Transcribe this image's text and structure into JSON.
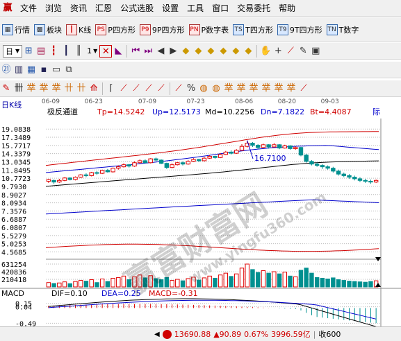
{
  "menu": {
    "logo": "赢",
    "items": [
      "文件",
      "浏览",
      "资讯",
      "汇恩",
      "公式选股",
      "设置",
      "工具",
      "窗口",
      "交易委托",
      "帮助"
    ]
  },
  "toolbar1": {
    "items": [
      "行情",
      "板块",
      "K线",
      "P四方形",
      "9P四方形",
      "P数字表",
      "T四方形",
      "9T四方形",
      "T数字"
    ]
  },
  "toolbar2": {
    "period": "日",
    "mode": "1"
  },
  "chart": {
    "title": "日K线",
    "indicator_name": "极反通道",
    "tp_label": "Tp=14.5242",
    "up_label": "Up=12.5173",
    "md_label": "Md=10.2256",
    "dn_label": "Dn=7.1822",
    "bt_label": "Bt=4.4087",
    "tail": "际",
    "date_labels": [
      "06-09",
      "06-23",
      "07-09",
      "07-23",
      "08-06",
      "08-20",
      "09-03"
    ],
    "price_ticks": [
      "19.0838",
      "17.3489",
      "15.7717",
      "14.3379",
      "13.0345",
      "11.8495",
      "10.7723",
      "9.7930",
      "8.9027",
      "8.0934",
      "7.3576",
      "6.6887",
      "6.0807",
      "5.5279",
      "5.0253",
      "4.5685"
    ],
    "peak_label": "16.7100",
    "volume_ticks": [
      "631254",
      "420836",
      "210418"
    ],
    "macd_title": "MACD",
    "dif_label": "DIF=0.10",
    "dea_label": "DEA=0.25",
    "macd_label": "MACD=-0.31",
    "macd_ticks": [
      "0.15",
      "0.04",
      "-0.49"
    ]
  },
  "chart_data": {
    "type": "candlestick",
    "candles": [
      [
        10.4,
        10.6,
        10.2,
        10.7
      ],
      [
        10.5,
        10.3,
        10.1,
        10.6
      ],
      [
        10.3,
        10.5,
        10.2,
        10.7
      ],
      [
        10.5,
        10.8,
        10.4,
        10.9
      ],
      [
        10.8,
        10.6,
        10.5,
        10.9
      ],
      [
        10.6,
        10.9,
        10.5,
        11.0
      ],
      [
        10.9,
        11.2,
        10.8,
        11.3
      ],
      [
        11.2,
        11.1,
        10.9,
        11.4
      ],
      [
        11.1,
        11.5,
        11.0,
        11.6
      ],
      [
        11.5,
        11.4,
        11.2,
        11.7
      ],
      [
        11.4,
        11.8,
        11.3,
        11.9
      ],
      [
        11.8,
        11.6,
        11.5,
        12.0
      ],
      [
        11.6,
        12.1,
        11.5,
        12.2
      ],
      [
        12.1,
        12.3,
        11.9,
        12.5
      ],
      [
        12.3,
        12.6,
        12.2,
        12.8
      ],
      [
        12.6,
        12.4,
        12.2,
        12.7
      ],
      [
        12.4,
        12.9,
        12.3,
        13.1
      ],
      [
        12.9,
        13.2,
        12.8,
        13.4
      ],
      [
        13.2,
        12.9,
        12.8,
        13.4
      ],
      [
        12.9,
        13.5,
        12.8,
        13.6
      ],
      [
        13.5,
        13.3,
        13.1,
        13.7
      ],
      [
        13.3,
        12.8,
        12.7,
        13.4
      ],
      [
        12.8,
        12.2,
        12.0,
        12.9
      ],
      [
        12.2,
        12.6,
        12.1,
        12.8
      ],
      [
        12.6,
        12.9,
        12.5,
        13.0
      ],
      [
        12.9,
        12.7,
        12.5,
        13.1
      ],
      [
        12.7,
        13.1,
        12.6,
        13.3
      ],
      [
        13.1,
        13.4,
        13.0,
        13.6
      ],
      [
        13.4,
        13.2,
        13.0,
        13.5
      ],
      [
        13.2,
        13.6,
        13.1,
        13.8
      ],
      [
        13.6,
        13.9,
        13.5,
        14.1
      ],
      [
        13.9,
        13.7,
        13.5,
        14.0
      ],
      [
        13.7,
        14.2,
        13.6,
        14.4
      ],
      [
        14.2,
        14.6,
        14.1,
        14.8
      ],
      [
        14.6,
        14.4,
        14.2,
        14.9
      ],
      [
        14.4,
        14.9,
        14.3,
        15.1
      ],
      [
        14.9,
        15.6,
        14.8,
        16.0
      ],
      [
        15.6,
        16.2,
        15.4,
        16.71
      ],
      [
        16.2,
        15.8,
        15.5,
        16.4
      ],
      [
        15.8,
        15.4,
        15.1,
        16.0
      ],
      [
        15.4,
        15.9,
        15.3,
        16.1
      ],
      [
        15.9,
        15.5,
        15.2,
        16.0
      ],
      [
        15.5,
        15.9,
        15.4,
        16.2
      ],
      [
        15.9,
        15.3,
        15.1,
        16.0
      ],
      [
        15.3,
        15.7,
        15.2,
        15.9
      ],
      [
        15.7,
        15.2,
        15.0,
        15.8
      ],
      [
        15.2,
        15.4,
        15.0,
        15.6
      ],
      [
        15.4,
        14.1,
        13.9,
        15.5
      ],
      [
        14.1,
        13.1,
        12.9,
        14.3
      ],
      [
        13.1,
        12.7,
        12.5,
        13.3
      ],
      [
        12.7,
        12.5,
        12.3,
        12.9
      ],
      [
        12.5,
        12.3,
        12.0,
        12.7
      ],
      [
        12.3,
        12.1,
        11.9,
        12.5
      ],
      [
        12.1,
        11.7,
        11.5,
        12.3
      ],
      [
        11.7,
        11.3,
        11.1,
        11.9
      ],
      [
        11.3,
        11.1,
        10.9,
        11.5
      ],
      [
        11.1,
        10.9,
        10.7,
        11.3
      ],
      [
        10.9,
        10.7,
        10.5,
        11.1
      ],
      [
        10.7,
        10.5,
        10.3,
        10.9
      ],
      [
        10.5,
        10.4,
        10.2,
        10.7
      ],
      [
        10.4,
        10.3,
        10.1,
        10.6
      ],
      [
        10.3,
        10.5,
        10.2,
        10.6
      ]
    ],
    "volumes": [
      120,
      95,
      110,
      140,
      90,
      150,
      180,
      160,
      200,
      120,
      220,
      150,
      240,
      260,
      300,
      200,
      280,
      330,
      250,
      310,
      230,
      200,
      260,
      180,
      210,
      170,
      230,
      270,
      190,
      250,
      300,
      240,
      330,
      380,
      290,
      360,
      520,
      631,
      480,
      400,
      450,
      380,
      420,
      360,
      410,
      300,
      280,
      460,
      520,
      380,
      260,
      240,
      220,
      250,
      200,
      180,
      160,
      150,
      140,
      130,
      150,
      170
    ],
    "xlabel": "",
    "ylabel": ""
  },
  "watermark": {
    "text1": "赢富财富网",
    "text2": "www.yingfu360.com"
  },
  "status": {
    "index_value": "13690.88",
    "change": "▲90.89",
    "percent": "0.67%",
    "amount": "3996.59亿",
    "tail": "收600"
  }
}
